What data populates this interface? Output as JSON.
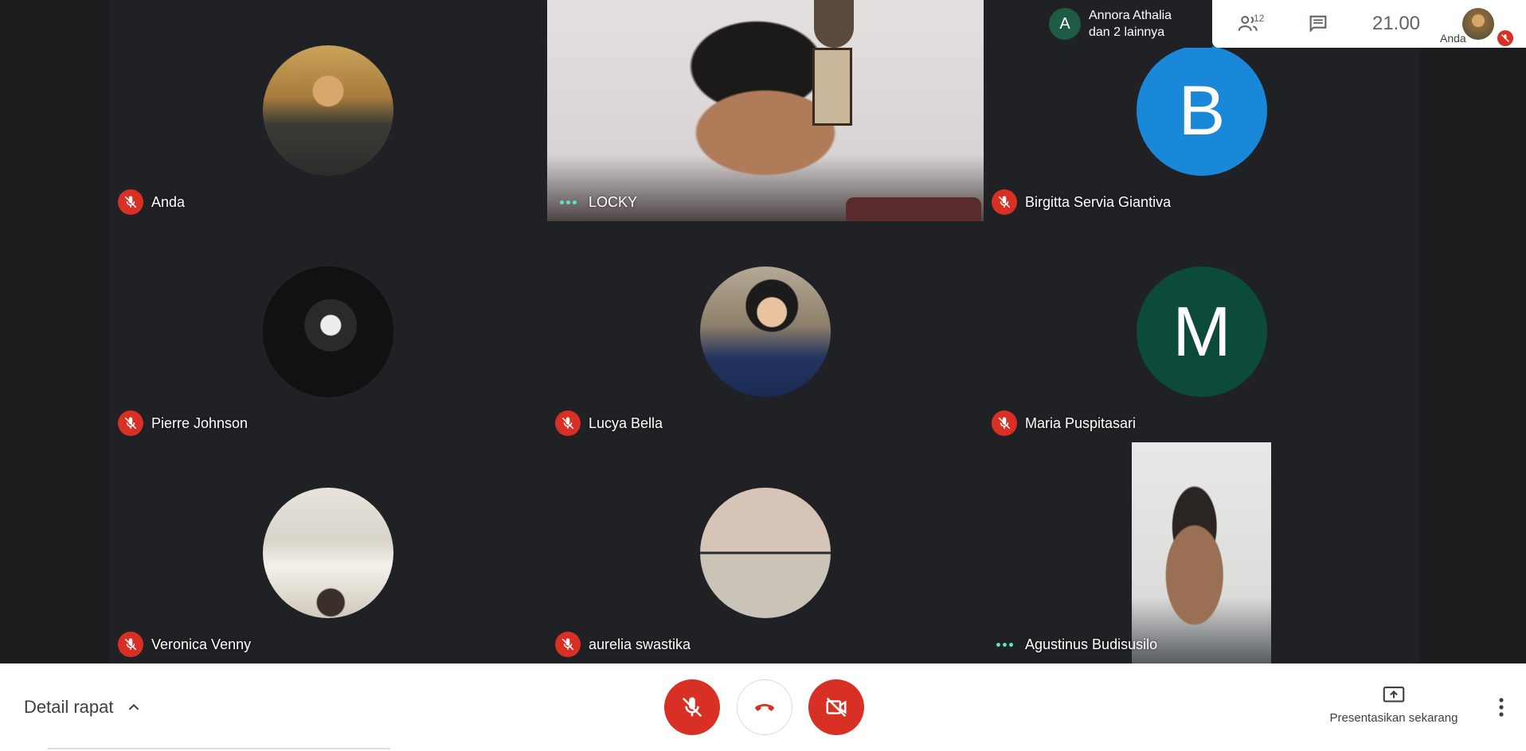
{
  "top": {
    "chip": {
      "avatar_letter": "A",
      "line1": "Annora Athalia",
      "line2": "dan 2 lainnya"
    },
    "people_count": "12",
    "clock": "21.00",
    "self_label": "Anda"
  },
  "participants": [
    {
      "name": "Anda",
      "muted": true,
      "view": "avatar",
      "photo": "anda"
    },
    {
      "name": "LOCKY",
      "muted": false,
      "view": "video",
      "photo": "locky"
    },
    {
      "name": "Birgitta Servia Giantiva",
      "muted": true,
      "view": "letter",
      "letter": "B",
      "color": "#1a88d9"
    },
    {
      "name": "Pierre Johnson",
      "muted": true,
      "view": "avatar",
      "photo": "pierre"
    },
    {
      "name": "Lucya Bella",
      "muted": true,
      "view": "avatar",
      "photo": "lucya"
    },
    {
      "name": "Maria Puspitasari",
      "muted": true,
      "view": "letter",
      "letter": "M",
      "color": "#0c4a3b"
    },
    {
      "name": "Veronica Venny",
      "muted": true,
      "view": "avatar",
      "photo": "veronica"
    },
    {
      "name": "aurelia swastika",
      "muted": true,
      "view": "avatar",
      "photo": "aurelia"
    },
    {
      "name": "Agustinus Budisusilo",
      "muted": false,
      "view": "video",
      "photo": "agustinus"
    }
  ],
  "bottom": {
    "details_label": "Detail rapat",
    "present_label": "Presentasikan sekarang"
  },
  "colors": {
    "accent_red": "#d93025",
    "grid_bg": "#202124"
  }
}
